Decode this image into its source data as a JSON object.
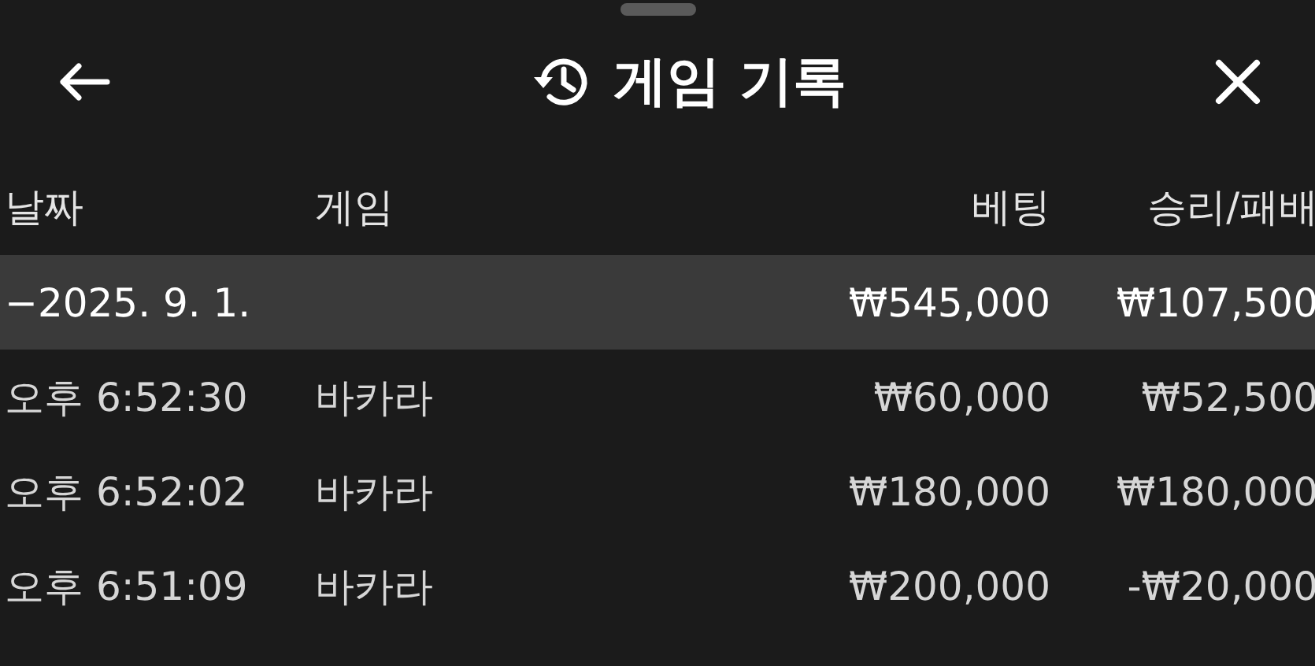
{
  "header": {
    "title": "게임 기록"
  },
  "table": {
    "columns": [
      "날짜",
      "게임",
      "베팅",
      "승리/패배"
    ],
    "rows": [
      {
        "kind": "group",
        "date": "−2025. 9. 1.",
        "game": "",
        "bet": "₩545,000",
        "result": "₩107,500"
      },
      {
        "kind": "entry",
        "date": "오후 6:52:30",
        "game": "바카라",
        "bet": "₩60,000",
        "result": "₩52,500"
      },
      {
        "kind": "entry",
        "date": "오후 6:52:02",
        "game": "바카라",
        "bet": "₩180,000",
        "result": "₩180,000"
      },
      {
        "kind": "entry",
        "date": "오후 6:51:09",
        "game": "바카라",
        "bet": "₩200,000",
        "result": "-₩20,000"
      }
    ]
  }
}
